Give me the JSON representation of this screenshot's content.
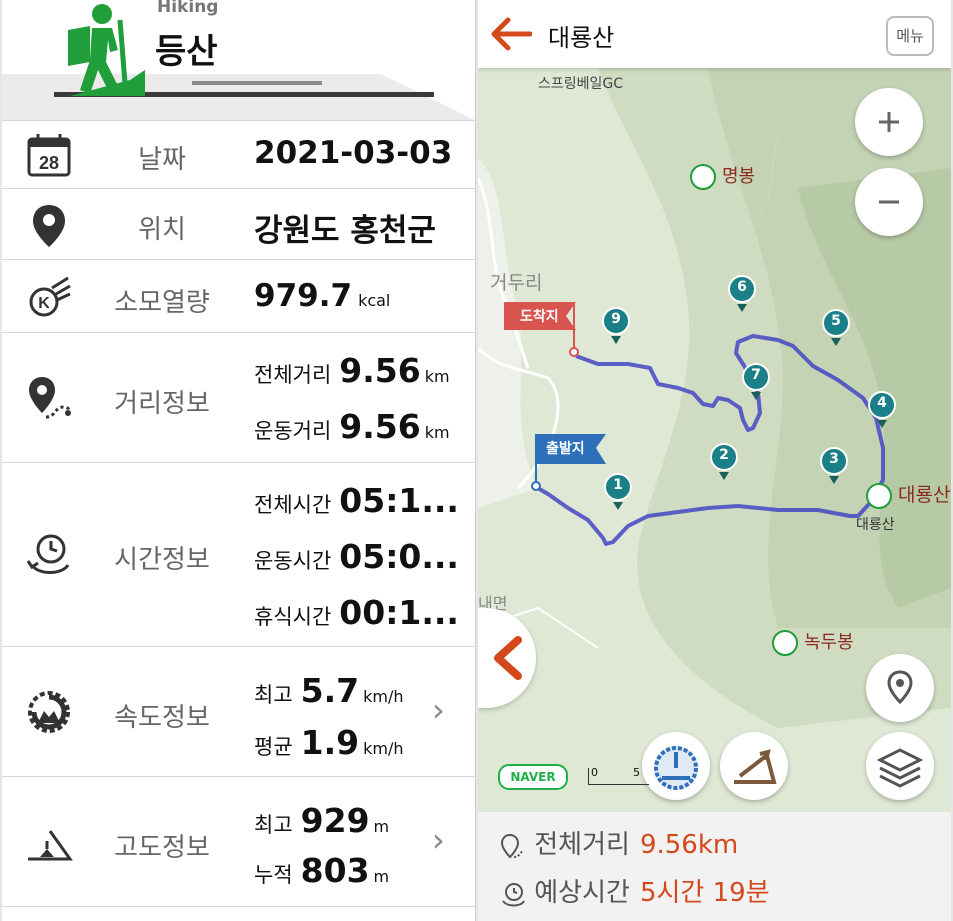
{
  "left": {
    "header": {
      "subtitle": "Hiking",
      "title": "등산"
    },
    "date": {
      "label": "날짜",
      "value": "2021-03-03",
      "icon_text": "28"
    },
    "location": {
      "label": "위치",
      "value": "강원도 홍천군"
    },
    "calories": {
      "label": "소모열량",
      "value": "979.7",
      "unit": "kcal",
      "icon_text": "K"
    },
    "distance": {
      "label": "거리정보",
      "items": [
        {
          "label": "전체거리",
          "value": "9.56",
          "unit": "km"
        },
        {
          "label": "운동거리",
          "value": "9.56",
          "unit": "km"
        }
      ]
    },
    "time": {
      "label": "시간정보",
      "items": [
        {
          "label": "전체시간",
          "value": "05:1..."
        },
        {
          "label": "운동시간",
          "value": "05:0..."
        },
        {
          "label": "휴식시간",
          "value": "00:1..."
        }
      ]
    },
    "speed": {
      "label": "속도정보",
      "items": [
        {
          "label": "최고",
          "value": "5.7",
          "unit": "km/h"
        },
        {
          "label": "평균",
          "value": "1.9",
          "unit": "km/h"
        }
      ]
    },
    "altitude": {
      "label": "고도정보",
      "items": [
        {
          "label": "최고",
          "value": "929",
          "unit": "m"
        },
        {
          "label": "누적",
          "value": "803",
          "unit": "m"
        }
      ]
    }
  },
  "right": {
    "title": "대룡산",
    "menu_label": "메뉴",
    "map": {
      "places": {
        "golf": "스프링베일GC",
        "myeongbong": "명봉",
        "geoduri": "거두리",
        "daeryongsan_peak": "대룡산",
        "daeryongsan_small": "대룡산",
        "nokdubong": "녹두봉",
        "naemyeon": "내면"
      },
      "flags": {
        "finish": "도착지",
        "start": "출발지"
      },
      "waypoints": [
        "1",
        "2",
        "3",
        "4",
        "5",
        "6",
        "7",
        "9"
      ],
      "scale": {
        "zero": "0",
        "five": "5"
      },
      "logo": "NAVER"
    },
    "summary": {
      "distance_label": "전체거리",
      "distance_value": "9.56km",
      "time_label": "예상시간",
      "time_value": "5시간 19분"
    }
  },
  "colors": {
    "accent": "#d4491c",
    "route": "#4b4fc4",
    "waypoint": "#1a7f86",
    "finish_flag": "#d9534f",
    "start_flag": "#2e6fba",
    "brand_green": "#1f9e3a"
  }
}
